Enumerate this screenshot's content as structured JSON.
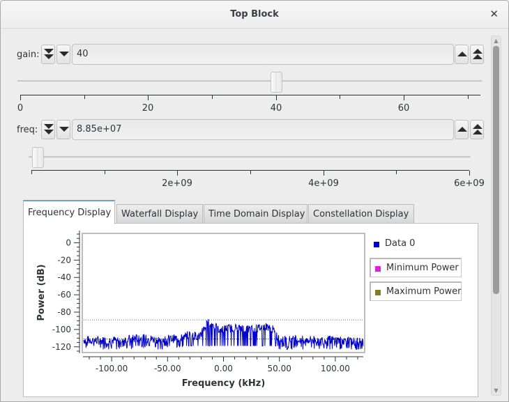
{
  "window": {
    "title": "Top Block",
    "close_icon": "close-icon"
  },
  "gain": {
    "label": "gain:",
    "value": "40",
    "slider_value": 40,
    "range": [
      0,
      72
    ],
    "major_ticks": [
      "0",
      "20",
      "40",
      "60"
    ],
    "major_tick_values": [
      0,
      20,
      40,
      60
    ],
    "minor_tick_values": [
      10,
      30,
      50,
      70
    ]
  },
  "freq": {
    "label": "freq:",
    "value": "8.85e+07",
    "slider_value": 88500000,
    "range": [
      0,
      6000000000
    ],
    "major_ticks": [
      "2e+09",
      "4e+09",
      "6e+09"
    ],
    "major_tick_values": [
      2000000000,
      4000000000,
      6000000000
    ],
    "minor_tick_values": [
      0,
      1000000000,
      3000000000,
      5000000000
    ]
  },
  "tabs": [
    {
      "label": "Frequency Display",
      "active": true
    },
    {
      "label": "Waterfall Display",
      "active": false
    },
    {
      "label": "Time Domain Display",
      "active": false
    },
    {
      "label": "Constellation Display",
      "active": false
    }
  ],
  "legend": [
    {
      "label": "Data 0",
      "color": "#0000cc"
    },
    {
      "label": "Minimum Power",
      "color": "#e020e0"
    },
    {
      "label": "Maximum Power",
      "color": "#808020"
    }
  ],
  "colors": {
    "trace": "#0000cc",
    "max_hold_line": "#33aa33",
    "min_hold_line": "#222222",
    "tab_accent": "#6d9ecf"
  },
  "chart_data": {
    "type": "line",
    "title": "",
    "xlabel": "Frequency (kHz)",
    "ylabel": "Power (dB)",
    "xlim": [
      -125,
      125
    ],
    "ylim": [
      -125,
      10
    ],
    "x_ticks": [
      -100,
      -50,
      0,
      50,
      100
    ],
    "x_tick_labels": [
      "-100.00",
      "-50.00",
      "0.00",
      "50.00",
      "100.00"
    ],
    "y_ticks": [
      0,
      -20,
      -40,
      -60,
      -80,
      -100,
      -120
    ],
    "y_tick_labels": [
      "0",
      "-20",
      "-40",
      "-60",
      "-80",
      "-100",
      "-120"
    ],
    "grid": false,
    "legend_position": "right",
    "series": [
      {
        "name": "Data 0",
        "description": "Noise floor about -113 dB with dips to -122; raised region -30 to +45 kHz around -100 dB; peak near -13 kHz at about -90 dB",
        "envelope": [
          {
            "x": -125,
            "y": -112
          },
          {
            "x": -110,
            "y": -113
          },
          {
            "x": -90,
            "y": -112
          },
          {
            "x": -75,
            "y": -110
          },
          {
            "x": -55,
            "y": -112
          },
          {
            "x": -40,
            "y": -110
          },
          {
            "x": -30,
            "y": -106
          },
          {
            "x": -22,
            "y": -108
          },
          {
            "x": -13,
            "y": -90
          },
          {
            "x": -5,
            "y": -100
          },
          {
            "x": 10,
            "y": -98
          },
          {
            "x": 25,
            "y": -100
          },
          {
            "x": 42,
            "y": -96
          },
          {
            "x": 50,
            "y": -112
          },
          {
            "x": 75,
            "y": -112
          },
          {
            "x": 100,
            "y": -112
          },
          {
            "x": 125,
            "y": -115
          }
        ]
      },
      {
        "name": "Maximum Power hold",
        "constant_y": -89
      },
      {
        "name": "Minimum Power hold",
        "constant_y": -111
      }
    ]
  }
}
